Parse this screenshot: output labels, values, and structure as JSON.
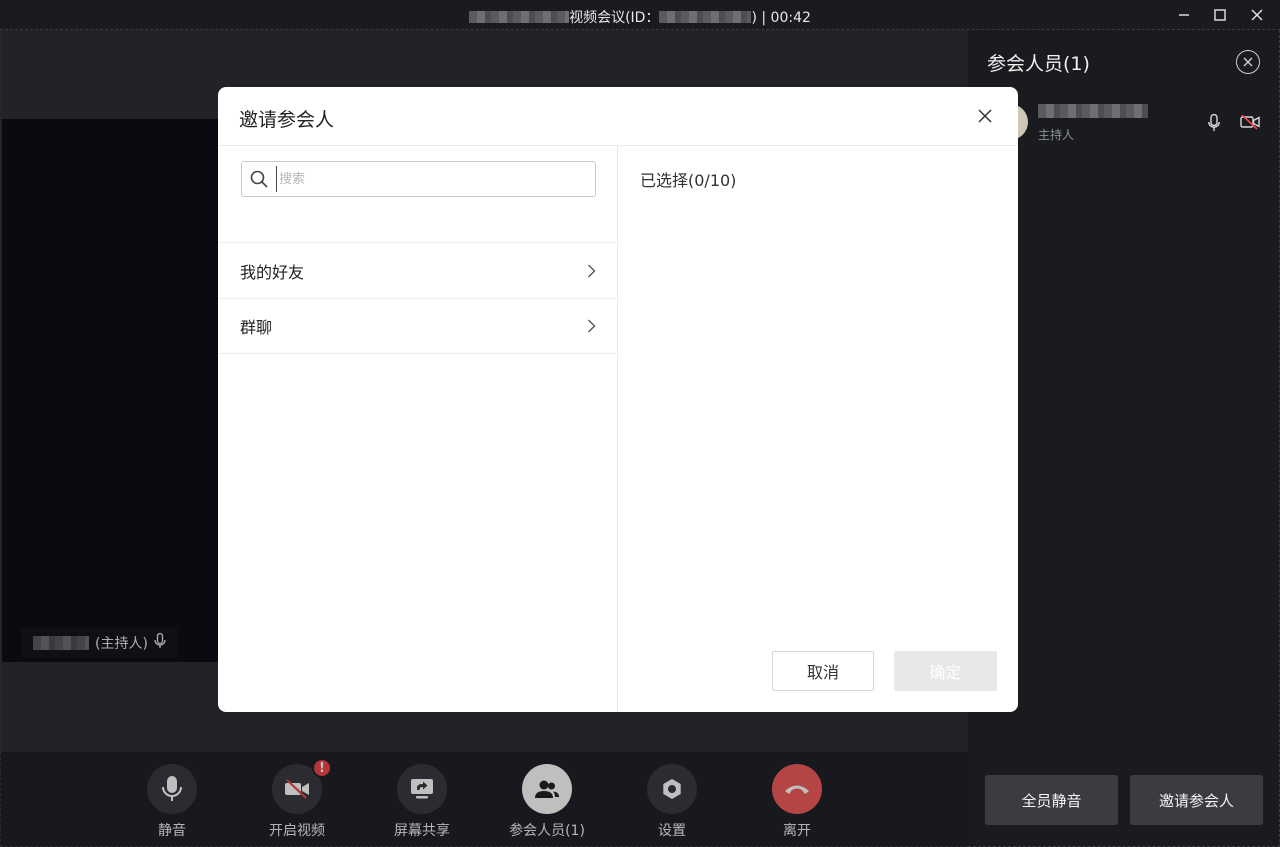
{
  "window": {
    "title_main": "视频会议(ID：",
    "title_tail": ") | 00:42"
  },
  "video": {
    "self_tag_role": "(主持人)"
  },
  "toolbar": {
    "items": [
      {
        "label": "静音",
        "icon": "microphone-icon"
      },
      {
        "label": "开启视频",
        "icon": "camera-off-icon",
        "badge": "!"
      },
      {
        "label": "屏幕共享",
        "icon": "screen-share-icon"
      },
      {
        "label": "参会人员(1)",
        "icon": "participants-icon",
        "active": true
      },
      {
        "label": "设置",
        "icon": "settings-icon"
      },
      {
        "label": "离开",
        "icon": "hang-up-icon",
        "color": "#f25c5c"
      }
    ]
  },
  "panel": {
    "title": "参会人员(1)",
    "participant_role": "主持人",
    "mute_all_label": "全员静音",
    "invite_label": "邀请参会人"
  },
  "dialog": {
    "title": "邀请参会人",
    "search_placeholder": "搜索",
    "categories": [
      {
        "label": "我的好友"
      },
      {
        "label": "群聊"
      }
    ],
    "selected_label": "已选择(0/10)",
    "cancel_label": "取消",
    "confirm_label": "确定"
  },
  "colors": {
    "leave": "#f25c5c",
    "badge": "#f2464b",
    "disabled_button": "#e8e8e8"
  }
}
